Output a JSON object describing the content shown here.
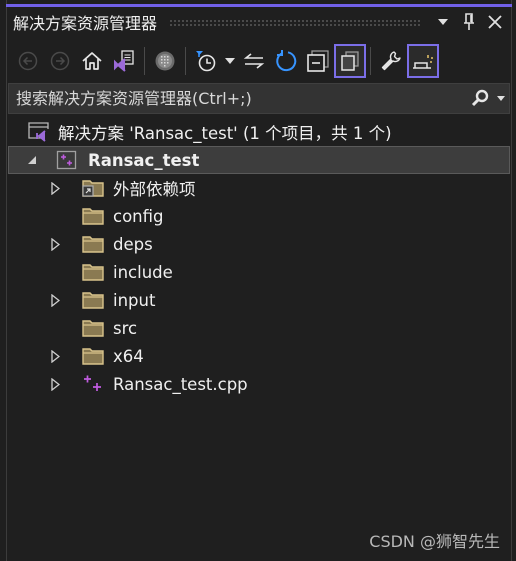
{
  "panel": {
    "title": "解决方案资源管理器",
    "accent_color": "#7160e8"
  },
  "title_buttons": [
    {
      "name": "window-position-dropdown",
      "icon": "triangle-down-icon"
    },
    {
      "name": "pin",
      "icon": "pin-icon"
    },
    {
      "name": "close",
      "icon": "close-icon"
    }
  ],
  "toolbar": {
    "items": [
      {
        "name": "back",
        "icon": "arrow-left-circle-icon",
        "enabled": false
      },
      {
        "name": "forward",
        "icon": "arrow-right-circle-icon",
        "enabled": false
      },
      {
        "name": "home",
        "icon": "home-icon",
        "enabled": true
      },
      {
        "name": "switch-views",
        "icon": "vs-solution-views-icon",
        "enabled": true
      },
      {
        "name": "show-all-files",
        "icon": "globe-grid-icon",
        "enabled": true
      },
      {
        "name": "pending-changes-filter",
        "icon": "clock-filter-icon",
        "enabled": true
      },
      {
        "name": "sync-with-active-document",
        "icon": "sync-arrows-icon",
        "enabled": true
      },
      {
        "name": "refresh",
        "icon": "refresh-icon",
        "enabled": true
      },
      {
        "name": "collapse-all",
        "icon": "collapse-all-icon",
        "enabled": true
      },
      {
        "name": "show-all-files-toggle",
        "icon": "copy-stack-icon",
        "enabled": true,
        "active": true
      },
      {
        "name": "properties",
        "icon": "wrench-icon",
        "enabled": true
      },
      {
        "name": "preview-selected-items",
        "icon": "preview-items-icon",
        "enabled": true,
        "active": true
      }
    ]
  },
  "search": {
    "placeholder": "搜索解决方案资源管理器(Ctrl+;)",
    "value": ""
  },
  "tree": {
    "solution": {
      "label": "解决方案 'Ransac_test' (1 个项目，共 1 个)"
    },
    "project": {
      "label": "Ransac_test",
      "expanded": true,
      "selected": true
    },
    "items": [
      {
        "label": "外部依赖项",
        "type": "external-dependencies",
        "expandable": true
      },
      {
        "label": "config",
        "type": "folder",
        "expandable": false
      },
      {
        "label": "deps",
        "type": "folder",
        "expandable": true
      },
      {
        "label": "include",
        "type": "folder",
        "expandable": false
      },
      {
        "label": "input",
        "type": "folder",
        "expandable": true
      },
      {
        "label": "src",
        "type": "folder",
        "expandable": false
      },
      {
        "label": "x64",
        "type": "folder",
        "expandable": true
      },
      {
        "label": "Ransac_test.cpp",
        "type": "cpp-file",
        "expandable": true
      }
    ]
  },
  "watermark": "CSDN @狮智先生"
}
